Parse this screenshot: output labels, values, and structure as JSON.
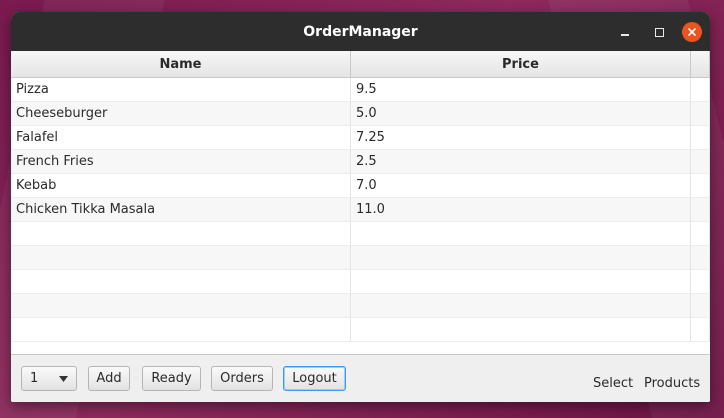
{
  "window": {
    "title": "OrderManager"
  },
  "table": {
    "columns": [
      "Name",
      "Price"
    ],
    "rows": [
      {
        "name": "Pizza",
        "price": "9.5"
      },
      {
        "name": "Cheeseburger",
        "price": "5.0"
      },
      {
        "name": "Falafel",
        "price": "7.25"
      },
      {
        "name": "French Fries",
        "price": "2.5"
      },
      {
        "name": "Kebab",
        "price": "7.0"
      },
      {
        "name": "Chicken Tikka Masala",
        "price": "11.0"
      }
    ]
  },
  "toolbar": {
    "quantity_value": "1",
    "add_label": "Add",
    "ready_label": "Ready",
    "orders_label": "Orders",
    "logout_label": "Logout"
  },
  "status": {
    "mode_label": "Select",
    "view_label": "Products"
  },
  "colors": {
    "accent_close": "#e95420",
    "titlebar": "#2d2d2d",
    "focus": "#3b99fc"
  }
}
